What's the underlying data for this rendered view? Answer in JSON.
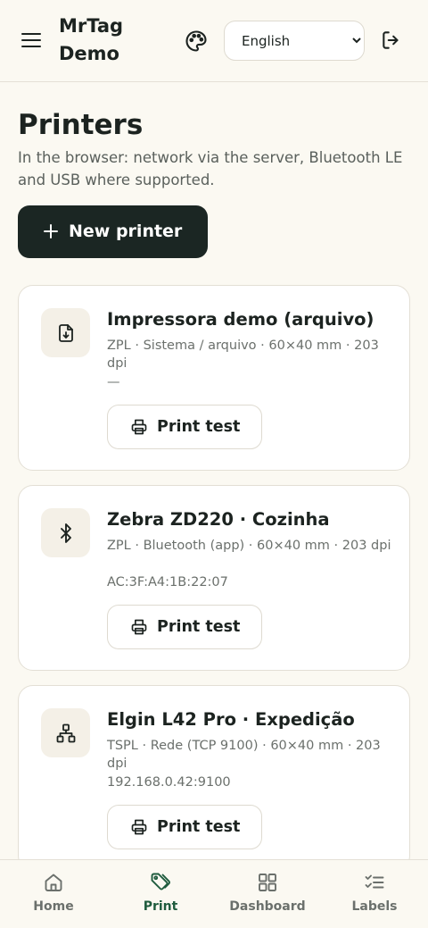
{
  "header": {
    "brand": "MrTag Demo",
    "language": {
      "selected": "English",
      "options": [
        "English"
      ]
    }
  },
  "page": {
    "title": "Printers",
    "subtitle": "In the browser: network via the server, Bluetooth LE and USB where supported.",
    "new_button_label": "New printer"
  },
  "printers": [
    {
      "name": "Impressora demo (arquivo)",
      "meta": "ZPL · Sistema / arquivo · 60×40 mm · 203 dpi",
      "address": "—",
      "icon": "file-download-icon",
      "test_label": "Print test"
    },
    {
      "name": "Zebra ZD220 · Cozinha",
      "meta": "ZPL · Bluetooth (app) · 60×40 mm · 203 dpi",
      "address": "AC:3F:A4:1B:22:07",
      "icon": "bluetooth-icon",
      "test_label": "Print test"
    },
    {
      "name": "Elgin L42 Pro · Expedição",
      "meta": "TSPL · Rede (TCP 9100) · 60×40 mm · 203 dpi",
      "address": "192.168.0.42:9100",
      "icon": "network-icon",
      "test_label": "Print test"
    }
  ],
  "bottom_nav": {
    "items": [
      {
        "label": "Home",
        "icon": "home-icon"
      },
      {
        "label": "Print",
        "icon": "tag-icon"
      },
      {
        "label": "Dashboard",
        "icon": "grid-icon"
      },
      {
        "label": "Labels",
        "icon": "checklist-icon"
      }
    ],
    "active": "Print"
  },
  "colors": {
    "background": "#fbf9f2",
    "primary_button": "#1b2623",
    "active_nav": "#1f5c3e",
    "muted_text": "#6b706c"
  }
}
